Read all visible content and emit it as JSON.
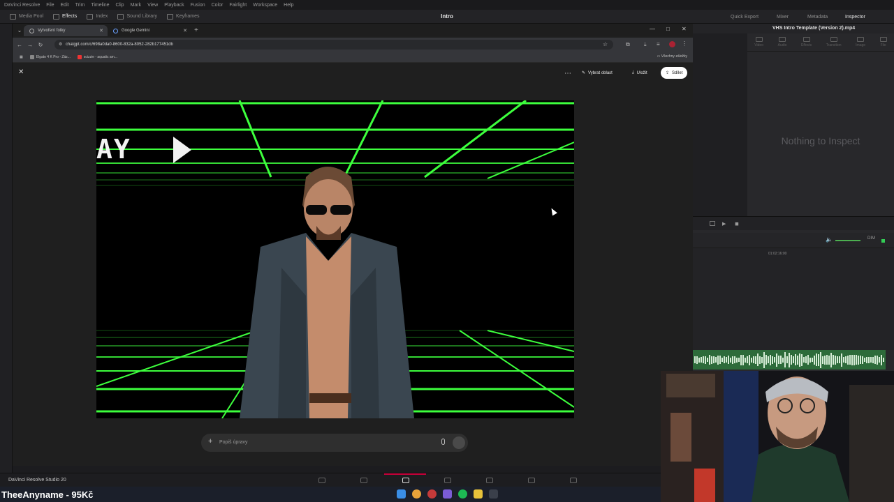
{
  "resolve": {
    "app_menu": [
      "DaVinci Resolve",
      "File",
      "Edit",
      "Trim",
      "Timeline",
      "Clip",
      "Mark",
      "View",
      "Playback",
      "Fusion",
      "Color",
      "Fairlight",
      "Workspace",
      "Help"
    ],
    "toolbar_left": [
      "Media Pool",
      "Effects",
      "Index",
      "Sound Library",
      "Keyframes"
    ],
    "active_toolbar": "Effects",
    "project_title": "Intro",
    "toolbar_right": [
      "Quick Export",
      "Mixer",
      "Metadata",
      "Inspector"
    ],
    "inspector_clip": "VHS Intro Template (Version 2).mp4",
    "inspector_tabs": [
      "Video",
      "Audio",
      "Effects",
      "Transition",
      "Image",
      "File"
    ],
    "inspector_empty": "Nothing to Inspect",
    "dim_label": "DIM",
    "timecode": "01:02:16:00",
    "brand": "DaVinci Resolve Studio 20",
    "accent_color": "#c8003a"
  },
  "browser": {
    "tabs": [
      {
        "title": "Vytvoření fotky",
        "active": true
      },
      {
        "title": "Google Gemini",
        "active": false
      }
    ],
    "url": "chatgpt.com/c/698a0da0-8600-832a-8052-282b177451db",
    "bookmarks": [
      "Elgato 4 K Pro - Záz...",
      "scizzie - aquatic am..."
    ],
    "all_bookmarks": "Všechny záložky"
  },
  "chatgpt": {
    "select_area_label": "Vybrat oblast",
    "save_label": "Uložit",
    "share_label": "Sdílet",
    "prompt_placeholder": "Popiš úpravy",
    "image_text": "AY"
  },
  "overlay": {
    "streamer_name": "TheeAnyname - 95Kč"
  },
  "colors": {
    "grid_green": "#3dff3d",
    "share_bg": "#ffffff",
    "audio_green": "#2d6b3a"
  }
}
